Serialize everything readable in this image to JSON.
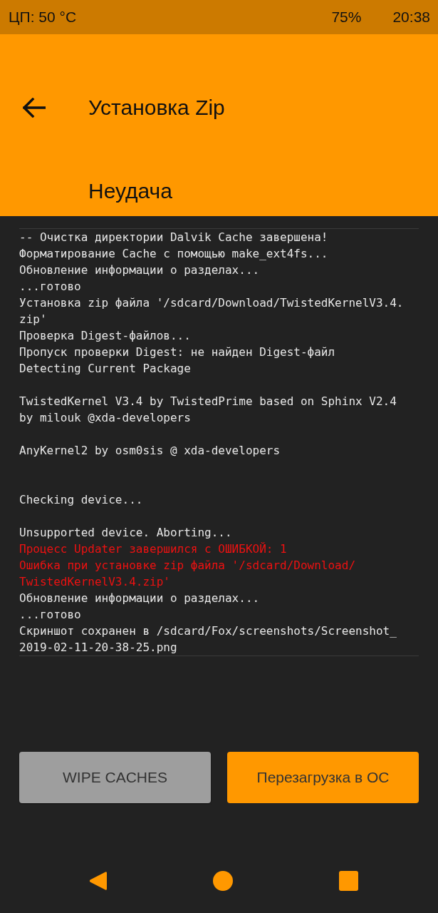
{
  "status_bar": {
    "cpu_temp": "ЦП: 50 °C",
    "battery": "75%",
    "time": "20:38"
  },
  "header": {
    "title": "Установка Zip",
    "status": "Неудача"
  },
  "log": [
    {
      "kind": "info",
      "text": "-- Очистка директории Dalvik Cache завершена!"
    },
    {
      "kind": "info",
      "text": "Форматирование Cache с помощью make_ext4fs..."
    },
    {
      "kind": "info",
      "text": "Обновление информации о разделах..."
    },
    {
      "kind": "info",
      "text": "...готово"
    },
    {
      "kind": "info",
      "text": "Установка zip файла '/sdcard/Download/TwistedKernelV3.4."
    },
    {
      "kind": "info",
      "text": "zip'"
    },
    {
      "kind": "info",
      "text": "Проверка Digest-файлов..."
    },
    {
      "kind": "info",
      "text": "Пропуск проверки Digest: не найден Digest-файл"
    },
    {
      "kind": "info",
      "text": "Detecting Current Package"
    },
    {
      "kind": "blank"
    },
    {
      "kind": "info",
      "text": "TwistedKernel V3.4 by TwistedPrime based on Sphinx V2.4"
    },
    {
      "kind": "info",
      "text": "by milouk @xda-developers"
    },
    {
      "kind": "blank"
    },
    {
      "kind": "info",
      "text": "AnyKernel2 by osm0sis @ xda-developers"
    },
    {
      "kind": "blank"
    },
    {
      "kind": "blank"
    },
    {
      "kind": "info",
      "text": "Checking device..."
    },
    {
      "kind": "blank"
    },
    {
      "kind": "info",
      "text": "Unsupported device. Aborting..."
    },
    {
      "kind": "error",
      "text": "Процесс Updater завершился с ОШИБКОЙ: 1"
    },
    {
      "kind": "error",
      "text": "Ошибка при установке zip файла '/sdcard/Download/"
    },
    {
      "kind": "error",
      "text": "TwistedKernelV3.4.zip'"
    },
    {
      "kind": "info",
      "text": "Обновление информации о разделах..."
    },
    {
      "kind": "info",
      "text": "...готово"
    },
    {
      "kind": "info",
      "text": "Скриншот сохранен в /sdcard/Fox/screenshots/Screenshot_"
    },
    {
      "kind": "info",
      "text": "2019-02-11-20-38-25.png"
    }
  ],
  "buttons": [
    {
      "label": "WIPE CACHES",
      "kind": "secondary"
    },
    {
      "label": "Перезагрузка в ОС",
      "kind": "primary"
    }
  ]
}
